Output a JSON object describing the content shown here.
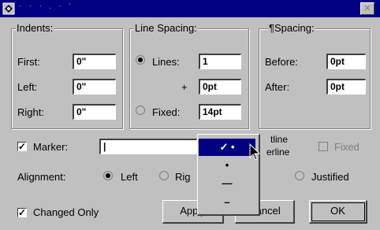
{
  "title": "· · · . · '",
  "groups": {
    "indents": {
      "legend": "Indents:",
      "first_label": "First:",
      "first_value": "0\"",
      "left_label": "Left:",
      "left_value": "0\"",
      "right_label": "Right:",
      "right_value": "0\""
    },
    "line_spacing": {
      "legend": "Line Spacing:",
      "lines_label": "Lines:",
      "lines_value": "1",
      "plus_label": "+",
      "plus_value": "0pt",
      "fixed_label": "Fixed:",
      "fixed_value": "14pt"
    },
    "para_spacing": {
      "legend": "¶Spacing:",
      "before_label": "Before:",
      "before_value": "0pt",
      "after_label": "After:",
      "after_value": "0pt"
    }
  },
  "marker": {
    "label": "Marker:",
    "value": "|",
    "checked": true
  },
  "popup": {
    "items": [
      "✓   •",
      "•",
      "—",
      "–"
    ]
  },
  "outline_label": "tline",
  "underline_label": "erline",
  "fixed_check_label": "Fixed",
  "alignment": {
    "label": "Alignment:",
    "left": "Left",
    "right": "Rig",
    "justified": "Justified"
  },
  "changed_only": {
    "label": "Changed Only",
    "checked": true
  },
  "buttons": {
    "apply": "Apply",
    "cancel": "Cancel",
    "ok": "OK"
  }
}
